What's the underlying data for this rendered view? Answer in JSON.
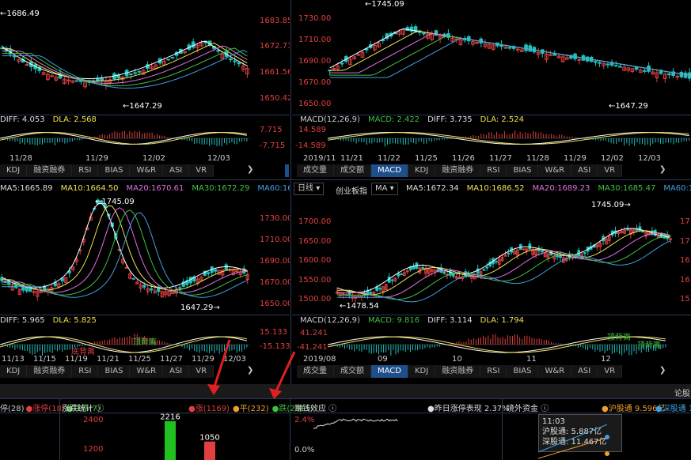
{
  "panels": {
    "tl": {
      "y_ticks": [
        "1683.85",
        "1672.71",
        "1661.56",
        "1650.42"
      ],
      "high_label": "1686.49",
      "low_label": "1647.29",
      "macd_line": [
        {
          "text": "DIFF: 4.053",
          "color": "#ddd"
        },
        {
          "text": "DLA: 2.568",
          "color": "#f0e050"
        }
      ],
      "macd_ticks": [
        "7.715",
        "-7.715"
      ],
      "x_ticks": [
        "11/28",
        "11/29",
        "12/02",
        "12/03"
      ],
      "tabs": [
        "KDJ",
        "融资融券",
        "RSI",
        "BIAS",
        "W&R",
        "ASI",
        "VR"
      ]
    },
    "tr": {
      "y_ticks": [
        "1730.00",
        "1710.00",
        "1690.00",
        "1670.00",
        "1650.00"
      ],
      "high_label": "1745.09",
      "low_label": "1647.29",
      "macd_line": [
        {
          "text": "MACD(12,26,9)",
          "color": "#ccc"
        },
        {
          "text": "MACD: 2.422",
          "color": "#40c040"
        },
        {
          "text": "DIFF: 3.735",
          "color": "#ddd"
        },
        {
          "text": "DLA: 2.524",
          "color": "#f0e050"
        }
      ],
      "macd_ticks": [
        "14.589",
        "-14.589"
      ],
      "x_ticks": [
        "2019/11",
        "11/21",
        "11/22",
        "11/25",
        "11/26",
        "11/27",
        "11/28",
        "11/29",
        "12/02",
        "12/03"
      ],
      "tabs": [
        "成交量",
        "成交额",
        "MACD",
        "KDJ",
        "融资融券",
        "RSI",
        "BIAS",
        "W&R",
        "ASI",
        "VR"
      ],
      "active_tab": 2
    },
    "ml": {
      "header": [
        {
          "text": "MA5:1665.89",
          "color": "#ddd"
        },
        {
          "text": "MA10:1664.50",
          "color": "#f0e050"
        },
        {
          "text": "MA20:1670.61",
          "color": "#e070e0"
        },
        {
          "text": "MA30:1672.29",
          "color": "#40c040"
        },
        {
          "text": "MA60:1684.66",
          "color": "#40a0e0"
        }
      ],
      "y_ticks": [
        "1730.00",
        "1710.00",
        "1690.00",
        "1670.00",
        "1650.00"
      ],
      "high_label": "1745.09",
      "low_label": "1647.29",
      "macd_line": [
        {
          "text": "DIFF: 5.965",
          "color": "#ddd"
        },
        {
          "text": "DLA: 5.825",
          "color": "#f0e050"
        }
      ],
      "macd_ticks": [
        "15.133",
        "-15.133"
      ],
      "annotations": [
        "顶背离",
        "底背离"
      ],
      "x_ticks": [
        "11/13",
        "11/15",
        "11/19",
        "11/21",
        "11/25",
        "11/27",
        "11/29",
        "12/03"
      ],
      "tabs": [
        "KDJ",
        "融资融券",
        "RSI",
        "BIAS",
        "W&R",
        "ASI",
        "VR"
      ]
    },
    "mr": {
      "period": "日线",
      "board": "创业板指",
      "indicator": "MA",
      "header": [
        {
          "text": "MA5:1672.34",
          "color": "#ddd"
        },
        {
          "text": "MA10:1686.52",
          "color": "#f0e050"
        },
        {
          "text": "MA20:1689.23",
          "color": "#e070e0"
        },
        {
          "text": "MA30:1685.47",
          "color": "#40c040"
        },
        {
          "text": "MA60:1679.2",
          "color": "#40a0e0"
        }
      ],
      "y_ticks": [
        "1700.00",
        "1650.00",
        "1600.00",
        "1550.00",
        "1500.00"
      ],
      "right_ticks": [
        "17",
        "17",
        "16",
        "16",
        "15"
      ],
      "high_label": "1745.09",
      "low_label": "1478.54",
      "macd_line": [
        {
          "text": "MACD(12,26,9)",
          "color": "#ccc"
        },
        {
          "text": "MACD: 9.816",
          "color": "#40c040"
        },
        {
          "text": "DIFF: 3.114",
          "color": "#ddd"
        },
        {
          "text": "DLA: 1.794",
          "color": "#f0e050"
        }
      ],
      "macd_ticks": [
        "41.241",
        "-41.241"
      ],
      "annotations": [
        "顶背离",
        "顶背离"
      ],
      "x_ticks": [
        "2019/08",
        "09",
        "10",
        "11",
        "12"
      ],
      "tabs": [
        "成交量",
        "成交额",
        "MACD",
        "KDJ",
        "融资融券",
        "RSI",
        "BIAS",
        "W&R",
        "ASI",
        "VR"
      ],
      "active_tab": 2
    }
  },
  "bottom": {
    "right_link": "论股",
    "stats_left": [
      {
        "text": "停(28)",
        "color": "#ccc"
      },
      {
        "text": "●涨停(18)",
        "color": "#e04040"
      },
      {
        "text": "●跌停(7)",
        "color": "#40c040"
      }
    ],
    "section1_title": "涨跌统计",
    "updown": [
      {
        "text": "●涨(1169)",
        "color": "#e04040"
      },
      {
        "text": "●平(232)",
        "color": "#f0a030"
      },
      {
        "text": "●跌(2315)",
        "color": "#40c040"
      }
    ],
    "section2_title": "赚钱效应",
    "zt_perf": "●昨日涨停表现 2.37%",
    "section3_title": "境外资金",
    "hgt_legend": "●沪股通 9.596亿",
    "sgt_legend": "●深股通 15.",
    "bar_ticks": [
      "2400",
      "1200"
    ],
    "bar_values": [
      "2216",
      "1050"
    ],
    "pct_ticks": [
      "2.4%",
      "0.0%"
    ],
    "tooltip": {
      "time": "11:03",
      "hgt": "沪股通: 5.887亿",
      "sgt": "深股通: 11.467亿"
    }
  },
  "chart_data": [
    {
      "type": "line",
      "title": "",
      "y_ticks": [
        1650.42,
        1661.56,
        1672.71,
        1683.85
      ],
      "high": 1686.49,
      "low": 1647.29,
      "x": [
        "11/28",
        "11/29",
        "12/02",
        "12/03"
      ]
    },
    {
      "type": "line",
      "title": "",
      "y_ticks": [
        1650,
        1670,
        1690,
        1710,
        1730
      ],
      "high": 1745.09,
      "low": 1647.29,
      "x": [
        "2019/11",
        "11/21",
        "11/22",
        "11/25",
        "11/26",
        "11/27",
        "11/28",
        "11/29",
        "12/02",
        "12/03"
      ]
    },
    {
      "type": "line",
      "title": "",
      "y_ticks": [
        1650,
        1670,
        1690,
        1710,
        1730
      ],
      "high": 1745.09,
      "low": 1647.29,
      "x": [
        "11/13",
        "11/15",
        "11/19",
        "11/21",
        "11/25",
        "11/27",
        "11/29",
        "12/03"
      ]
    },
    {
      "type": "line",
      "title": "",
      "y_ticks": [
        1500,
        1550,
        1600,
        1650,
        1700
      ],
      "high": 1745.09,
      "low": 1478.54,
      "x": [
        "2019/08",
        "09",
        "10",
        "11",
        "12"
      ]
    },
    {
      "type": "bar",
      "categories": [
        "涨",
        "跌"
      ],
      "values": [
        2216,
        1050
      ],
      "ylim": [
        0,
        2400
      ]
    }
  ]
}
